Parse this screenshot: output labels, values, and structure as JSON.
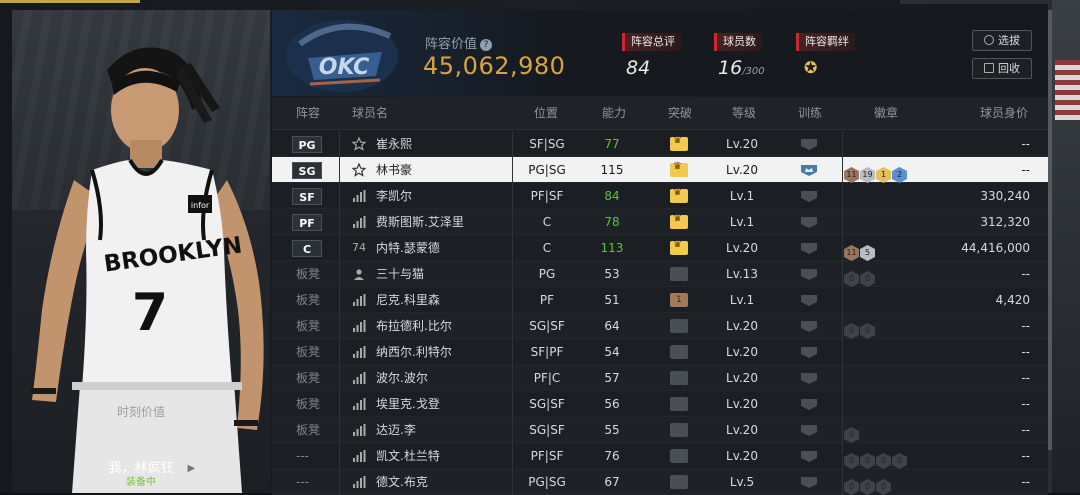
{
  "player_card": {
    "current_value_label": "时刻价值",
    "current_value": "——",
    "nickname": "我，林疯狂",
    "status": "装备中",
    "jersey_team": "BROOKLYN",
    "jersey_number": "7",
    "sponsor_patch": "infor"
  },
  "header": {
    "team_logo": "OKC",
    "team_value_label": "阵容价值",
    "team_value": "45,062,980",
    "stats": [
      {
        "label": "阵容总评",
        "value": "84",
        "sub": ""
      },
      {
        "label": "球员数",
        "value": "16",
        "sub": "/300"
      },
      {
        "label": "阵容羁绊",
        "value": "",
        "sub": ""
      }
    ],
    "buttons": [
      {
        "label": "选拔",
        "icon": "refresh-icon"
      },
      {
        "label": "回收",
        "icon": "recycle-icon"
      }
    ]
  },
  "table": {
    "columns": [
      "阵容",
      "球员名",
      "位置",
      "能力",
      "突破",
      "等级",
      "训练",
      "徽章",
      "球员身价"
    ],
    "rows": [
      {
        "slot": "PG",
        "starter": true,
        "rank_icon": "star",
        "name": "崔永熙",
        "pos": "SF|SG",
        "ovr": "77",
        "ovr_up": true,
        "breakthrough": "gold",
        "level": "Lv.20",
        "training": "",
        "badges": [],
        "value": "--"
      },
      {
        "slot": "SG",
        "starter": true,
        "rank_icon": "star",
        "name": "林书豪",
        "pos": "PG|SG",
        "ovr": "115",
        "ovr_up": false,
        "breakthrough": "gold",
        "level": "Lv.20",
        "training": "crown",
        "badges": [
          {
            "t": "bronze",
            "n": "11"
          },
          {
            "t": "silver",
            "n": "19"
          },
          {
            "t": "gold",
            "n": "1"
          },
          {
            "t": "blue",
            "n": "2"
          }
        ],
        "value": "--",
        "selected": true
      },
      {
        "slot": "SF",
        "starter": true,
        "rank_icon": "bars",
        "name": "李凯尔",
        "pos": "PF|SF",
        "ovr": "84",
        "ovr_up": true,
        "breakthrough": "gold",
        "level": "Lv.1",
        "training": "",
        "badges": [],
        "value": "330,240"
      },
      {
        "slot": "PF",
        "starter": true,
        "rank_icon": "bars",
        "name": "费斯图斯.艾泽里",
        "pos": "C",
        "ovr": "78",
        "ovr_up": true,
        "breakthrough": "gold",
        "level": "Lv.1",
        "training": "",
        "badges": [],
        "value": "312,320"
      },
      {
        "slot": "C",
        "starter": true,
        "rank_icon": "74",
        "name": "内特.瑟蒙德",
        "pos": "C",
        "ovr": "113",
        "ovr_up": true,
        "breakthrough": "gold",
        "level": "Lv.20",
        "training": "",
        "badges": [
          {
            "t": "bronze",
            "n": "11"
          },
          {
            "t": "silver",
            "n": "5"
          }
        ],
        "value": "44,416,000"
      },
      {
        "slot": "板凳",
        "starter": false,
        "rank_icon": "person",
        "name": "三十与猫",
        "pos": "PG",
        "ovr": "53",
        "ovr_up": false,
        "breakthrough": "gray",
        "level": "Lv.13",
        "training": "",
        "badges": [
          {
            "t": "empty",
            "n": "0"
          },
          {
            "t": "empty",
            "n": "0"
          }
        ],
        "value": "--"
      },
      {
        "slot": "板凳",
        "starter": false,
        "rank_icon": "bars",
        "name": "尼克.科里森",
        "pos": "PF",
        "ovr": "51",
        "ovr_up": false,
        "breakthrough": "brown",
        "level": "Lv.1",
        "training": "",
        "badges": [],
        "value": "4,420"
      },
      {
        "slot": "板凳",
        "starter": false,
        "rank_icon": "bars",
        "name": "布拉德利.比尔",
        "pos": "SG|SF",
        "ovr": "64",
        "ovr_up": false,
        "breakthrough": "gray",
        "level": "Lv.20",
        "training": "",
        "badges": [
          {
            "t": "empty",
            "n": "0"
          },
          {
            "t": "empty",
            "n": "0"
          }
        ],
        "value": "--"
      },
      {
        "slot": "板凳",
        "starter": false,
        "rank_icon": "bars",
        "name": "纳西尔.利特尔",
        "pos": "SF|PF",
        "ovr": "54",
        "ovr_up": false,
        "breakthrough": "gray",
        "level": "Lv.20",
        "training": "",
        "badges": [],
        "value": "--"
      },
      {
        "slot": "板凳",
        "starter": false,
        "rank_icon": "bars",
        "name": "波尔.波尔",
        "pos": "PF|C",
        "ovr": "57",
        "ovr_up": false,
        "breakthrough": "gray",
        "level": "Lv.20",
        "training": "",
        "badges": [],
        "value": "--"
      },
      {
        "slot": "板凳",
        "starter": false,
        "rank_icon": "bars",
        "name": "埃里克.戈登",
        "pos": "SG|SF",
        "ovr": "56",
        "ovr_up": false,
        "breakthrough": "gray",
        "level": "Lv.20",
        "training": "",
        "badges": [],
        "value": "--"
      },
      {
        "slot": "板凳",
        "starter": false,
        "rank_icon": "bars",
        "name": "达迈.李",
        "pos": "SG|SF",
        "ovr": "55",
        "ovr_up": false,
        "breakthrough": "gray",
        "level": "Lv.20",
        "training": "",
        "badges": [
          {
            "t": "empty",
            "n": "0"
          }
        ],
        "value": "--"
      },
      {
        "slot": "---",
        "starter": false,
        "rank_icon": "bars",
        "name": "凯文.杜兰特",
        "pos": "PF|SF",
        "ovr": "76",
        "ovr_up": false,
        "breakthrough": "gray",
        "level": "Lv.20",
        "training": "",
        "badges": [
          {
            "t": "empty",
            "n": "0"
          },
          {
            "t": "empty",
            "n": "0"
          },
          {
            "t": "empty",
            "n": "0"
          },
          {
            "t": "empty",
            "n": "0"
          }
        ],
        "value": "--"
      },
      {
        "slot": "---",
        "starter": false,
        "rank_icon": "bars",
        "name": "德文.布克",
        "pos": "PG|SG",
        "ovr": "67",
        "ovr_up": false,
        "breakthrough": "gray",
        "level": "Lv.5",
        "training": "",
        "badges": [
          {
            "t": "empty",
            "n": "0"
          },
          {
            "t": "empty",
            "n": "0"
          },
          {
            "t": "empty",
            "n": "0"
          }
        ],
        "value": "--"
      }
    ]
  },
  "colors": {
    "accent_gold": "#d6a441",
    "tag_red": "#d0262d",
    "ovr_green": "#5ec13a",
    "selected_row": "#f2f2f2"
  }
}
